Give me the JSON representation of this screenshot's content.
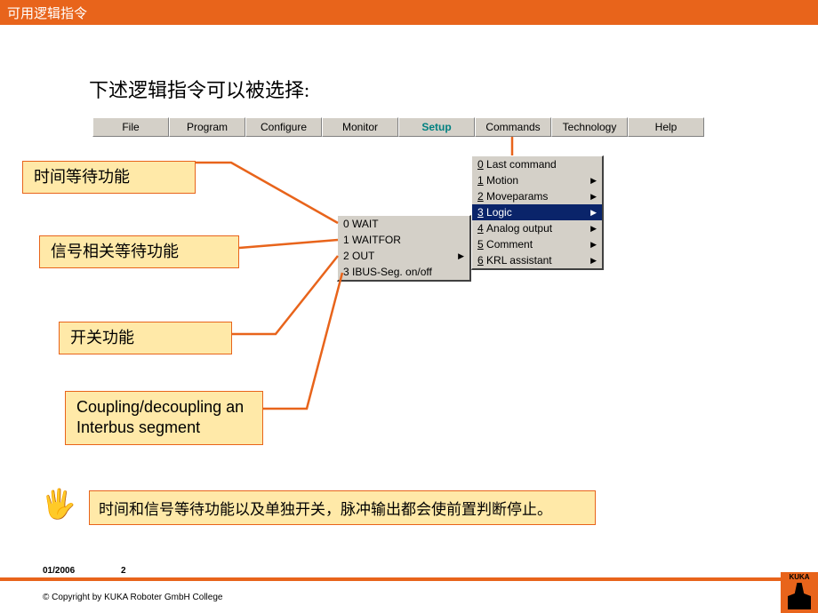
{
  "title": "可用逻辑指令",
  "intro": "下述逻辑指令可以被选择:",
  "menubar": [
    "File",
    "Program",
    "Configure",
    "Monitor",
    "Setup",
    "Commands",
    "Technology",
    "Help"
  ],
  "commands_menu": [
    {
      "key": "0",
      "label": "Last command",
      "arrow": false
    },
    {
      "key": "1",
      "label": "Motion",
      "arrow": true
    },
    {
      "key": "2",
      "label": "Moveparams",
      "arrow": true
    },
    {
      "key": "3",
      "label": "Logic",
      "arrow": true,
      "selected": true
    },
    {
      "key": "4",
      "label": "Analog output",
      "arrow": true
    },
    {
      "key": "5",
      "label": "Comment",
      "arrow": true
    },
    {
      "key": "6",
      "label": "KRL assistant",
      "arrow": true
    }
  ],
  "logic_menu": [
    {
      "key": "0",
      "label": "WAIT",
      "arrow": false
    },
    {
      "key": "1",
      "label": "WAITFOR",
      "arrow": false
    },
    {
      "key": "2",
      "label": "OUT",
      "arrow": true
    },
    {
      "key": "3",
      "label": "IBUS-Seg. on/off",
      "arrow": false
    }
  ],
  "callouts": {
    "c1": "时间等待功能",
    "c2": "信号相关等待功能",
    "c3": "开关功能",
    "c4": "Coupling/decoupling an Interbus segment"
  },
  "note": "时间和信号等待功能以及单独开关，脉冲输出都会使前置判断停止。",
  "footer": {
    "date": "01/2006",
    "page": "2",
    "copyright": "© Copyright by KUKA Roboter GmbH College",
    "logo": "KUKA"
  }
}
